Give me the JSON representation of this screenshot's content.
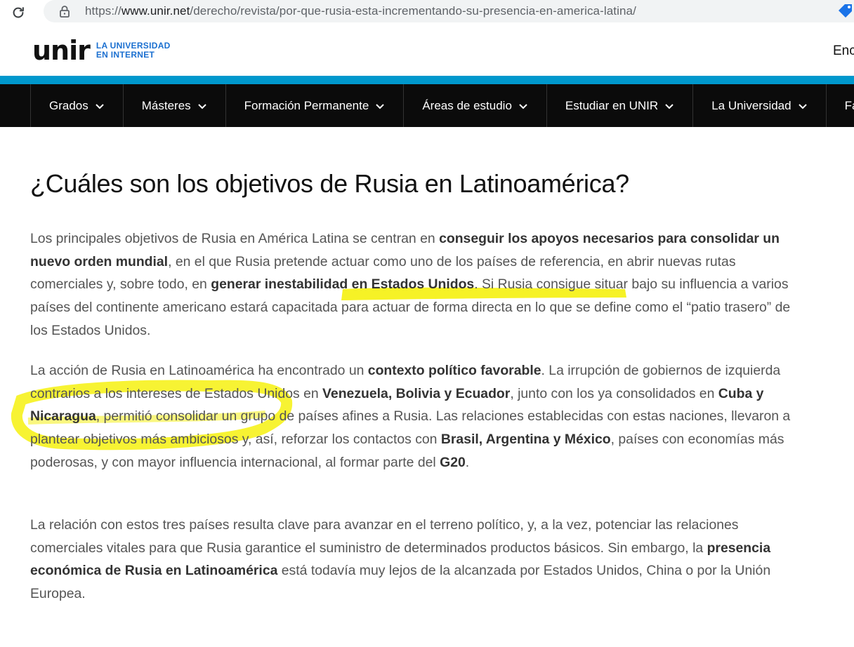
{
  "browser": {
    "url_prefix": "https://",
    "url_domain": "www.unir.net",
    "url_path": "/derecho/revista/por-que-rusia-esta-incrementando-su-presencia-en-america-latina/"
  },
  "header": {
    "logo_word": "unir",
    "logo_line1": "LA UNIVERSIDAD",
    "logo_line2": "EN INTERNET",
    "right_link": "Enc"
  },
  "nav": {
    "items": [
      {
        "label": "Grados"
      },
      {
        "label": "Másteres"
      },
      {
        "label": "Formación Permanente"
      },
      {
        "label": "Áreas de estudio"
      },
      {
        "label": "Estudiar en UNIR"
      },
      {
        "label": "La Universidad"
      },
      {
        "label": "Facu"
      }
    ]
  },
  "article": {
    "heading": "¿Cuáles son los objetivos de Rusia en Latinoamérica?",
    "p1": {
      "t1": "Los principales objetivos de Rusia en América Latina se centran en ",
      "b1": "conseguir los apoyos necesarios para consolidar un nuevo orden mundial",
      "t2": ", en el que Rusia pretende actuar como uno de los países de referencia, en abrir nuevas rutas comerciales y, sobre todo, en ",
      "b2": "generar inestabilidad en Estados Unidos",
      "t3": ". Si Rusia consigue situar bajo su influencia a varios países del continente americano estará capacitada para actuar de forma directa en lo que se define como el “patio trasero” de los Estados Unidos."
    },
    "p2": {
      "t1": "La acción de Rusia en Latinoamérica ha encontrado un ",
      "b1": "contexto político favorable",
      "t2": ". La irrupción de gobiernos de izquierda contrarios a los intereses de Estados Unidos en ",
      "b2": "Venezuela, Bolivia y Ecuador",
      "t3": ", junto con los ya consolidados en ",
      "b3": "Cuba y Nicaragua",
      "t4": ", permitió consolidar un grupo de países afines a Rusia. Las relaciones establecidas con estas naciones, llevaron a plantear objetivos más ambiciosos y, así, reforzar los contactos con ",
      "b4": "Brasil, Argentina y México",
      "t5": ", países con economías más poderosas, y con mayor influencia internacional, al formar parte del ",
      "b5": "G20",
      "t6": "."
    },
    "p3": {
      "t1": "La relación con estos tres países resulta clave para avanzar en el terreno político, y, a la vez, potenciar las relaciones comerciales vitales para que Rusia garantice el suministro de determinados productos básicos. Sin embargo, la ",
      "b1": "presencia económica de Rusia en Latinoamérica",
      "t2": " está todavía muy lejos de la alcanzada por Estados Unidos, China o por la Unión Europea."
    }
  },
  "colors": {
    "accent_blue": "#0098cd",
    "nav_bg": "#0b0b0b",
    "highlighter": "#f5f000"
  },
  "icons": [
    "reload-icon",
    "lock-icon",
    "tag-icon",
    "chevron-down-icon"
  ]
}
